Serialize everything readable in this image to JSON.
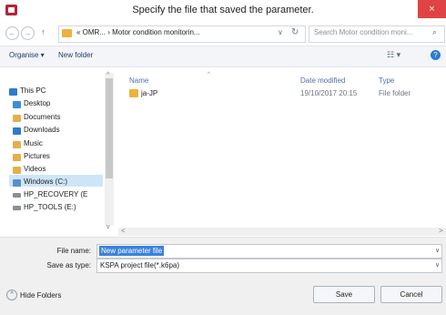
{
  "window": {
    "title": "Specify the file that saved the parameter.",
    "close_glyph": "×"
  },
  "address": {
    "back_glyph": "←",
    "forward_glyph": "→",
    "up_glyph": "↑",
    "path": "« OMR... › Motor condition monitorin...",
    "dropdown_glyph": "∨",
    "refresh_glyph": "↻",
    "search_placeholder": "Search Motor condition moni...",
    "search_glyph": "⌕"
  },
  "toolbar": {
    "organise_label": "Organise ▾",
    "new_folder_label": "New folder",
    "view_glyph": "☷ ▾",
    "help_glyph": "?"
  },
  "nav": {
    "items": [
      {
        "label": "This PC",
        "color": "#2a7dd1"
      },
      {
        "label": "Desktop",
        "color": "#3a8fd8"
      },
      {
        "label": "Documents",
        "color": "#e3b04b"
      },
      {
        "label": "Downloads",
        "color": "#2f7cc6"
      },
      {
        "label": "Music",
        "color": "#e3b04b"
      },
      {
        "label": "Pictures",
        "color": "#e3b04b"
      },
      {
        "label": "Videos",
        "color": "#e3b04b"
      },
      {
        "label": "Windows (C:)",
        "color": "#5b8fc9"
      },
      {
        "label": "HP_RECOVERY (E",
        "color": "#8a8f96"
      },
      {
        "label": "HP_TOOLS (E:)",
        "color": "#8a8f96"
      }
    ],
    "scroll_up": "^",
    "scroll_down": "v"
  },
  "files": {
    "columns": {
      "name": "Name",
      "date": "Date modified",
      "type": "Type"
    },
    "rows": [
      {
        "name": "ja-JP",
        "date": "19/10/2017 20:15",
        "type": "File folder"
      }
    ],
    "hscroll_left": "<",
    "hscroll_right": ">"
  },
  "form": {
    "file_name_label": "File name:",
    "file_name_value": "New parameter file",
    "save_type_label": "Save as type:",
    "save_type_value": "KSPA project file(*.k6pa)"
  },
  "footer": {
    "hide_folders_label": "Hide Folders",
    "hide_folders_glyph": "^",
    "save_label": "Save",
    "cancel_label": "Cancel"
  },
  "colors": {
    "accent": "#3b82dc",
    "close": "#e04343",
    "folder": "#e9b33e"
  }
}
